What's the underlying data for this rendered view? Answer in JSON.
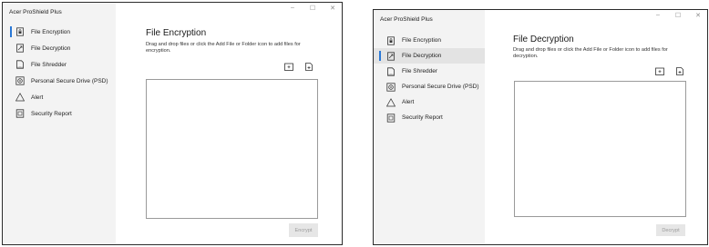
{
  "app_title": "Acer ProShield Plus",
  "window_controls": {
    "minimize": "–",
    "maximize": "☐",
    "close": "✕"
  },
  "nav_items": [
    {
      "label": "File Encryption",
      "icon": "file-lock-icon"
    },
    {
      "label": "File Decryption",
      "icon": "file-unlock-icon"
    },
    {
      "label": "File Shredder",
      "icon": "shredder-icon"
    },
    {
      "label": "Personal Secure Drive (PSD)",
      "icon": "secure-drive-icon"
    },
    {
      "label": "Alert",
      "icon": "alert-triangle-icon"
    },
    {
      "label": "Security Report",
      "icon": "security-report-icon"
    }
  ],
  "encryption_page": {
    "title": "File Encryption",
    "description": "Drag and drop files or click the Add File or Folder icon to add files for encryption.",
    "action_label": "Encrypt"
  },
  "decryption_page": {
    "title": "File Decryption",
    "description": "Drag and drop files or click the Add File or Folder icon to add files for decryption.",
    "action_label": "Decrypt"
  },
  "toolbar": {
    "add_folder_icon": "add-folder-icon",
    "add_file_icon": "add-file-icon"
  },
  "colors": {
    "accent": "#2a78d6",
    "sidebar_bg": "#f3f3f3",
    "selected_bg": "#e3e3e3",
    "disabled_button_bg": "#e6e6e6"
  }
}
